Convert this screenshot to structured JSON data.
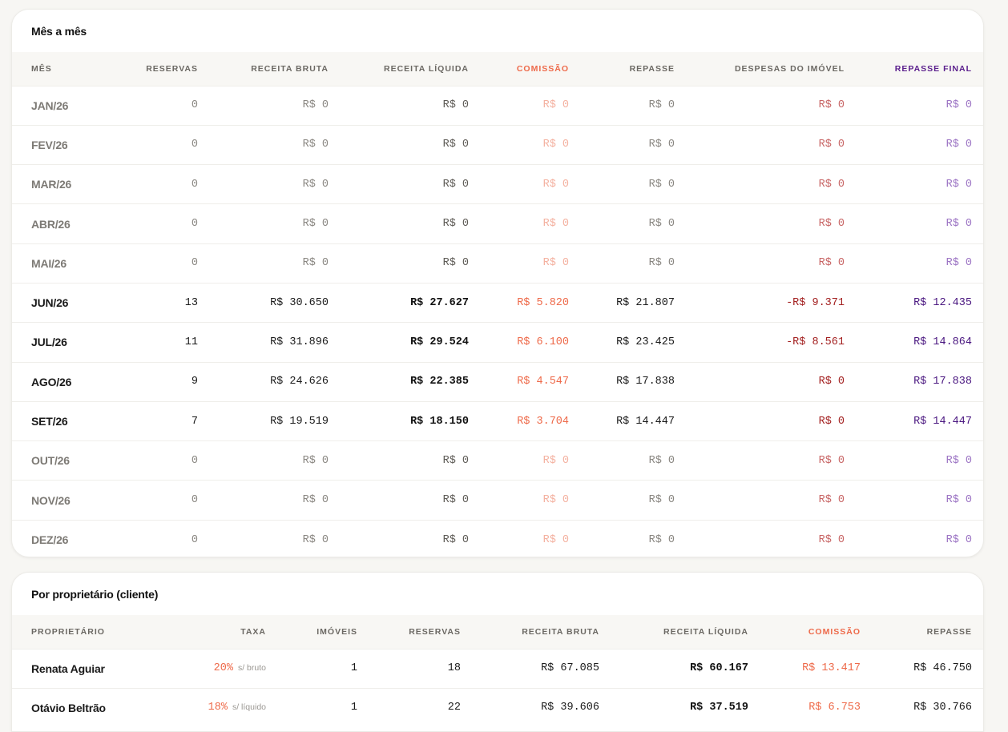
{
  "monthly": {
    "title": "Mês a mês",
    "headers": {
      "month": "MÊS",
      "bookings": "RESERVAS",
      "gross": "RECEITA BRUTA",
      "net": "RECEITA LÍQUIDA",
      "commission": "COMISSÃO",
      "payout": "REPASSE",
      "expenses": "DESPESAS DO IMÓVEL",
      "final": "REPASSE FINAL"
    },
    "rows": [
      {
        "month": "JAN/26",
        "bookings": "0",
        "gross": "R$ 0",
        "net": "R$ 0",
        "commission": "R$ 0",
        "payout": "R$ 0",
        "expenses": "R$ 0",
        "final": "R$ 0",
        "empty": true
      },
      {
        "month": "FEV/26",
        "bookings": "0",
        "gross": "R$ 0",
        "net": "R$ 0",
        "commission": "R$ 0",
        "payout": "R$ 0",
        "expenses": "R$ 0",
        "final": "R$ 0",
        "empty": true
      },
      {
        "month": "MAR/26",
        "bookings": "0",
        "gross": "R$ 0",
        "net": "R$ 0",
        "commission": "R$ 0",
        "payout": "R$ 0",
        "expenses": "R$ 0",
        "final": "R$ 0",
        "empty": true
      },
      {
        "month": "ABR/26",
        "bookings": "0",
        "gross": "R$ 0",
        "net": "R$ 0",
        "commission": "R$ 0",
        "payout": "R$ 0",
        "expenses": "R$ 0",
        "final": "R$ 0",
        "empty": true
      },
      {
        "month": "MAI/26",
        "bookings": "0",
        "gross": "R$ 0",
        "net": "R$ 0",
        "commission": "R$ 0",
        "payout": "R$ 0",
        "expenses": "R$ 0",
        "final": "R$ 0",
        "empty": true
      },
      {
        "month": "JUN/26",
        "bookings": "13",
        "gross": "R$ 30.650",
        "net": "R$ 27.627",
        "commission": "R$ 5.820",
        "payout": "R$ 21.807",
        "expenses": "-R$ 9.371",
        "final": "R$ 12.435",
        "empty": false
      },
      {
        "month": "JUL/26",
        "bookings": "11",
        "gross": "R$ 31.896",
        "net": "R$ 29.524",
        "commission": "R$ 6.100",
        "payout": "R$ 23.425",
        "expenses": "-R$ 8.561",
        "final": "R$ 14.864",
        "empty": false
      },
      {
        "month": "AGO/26",
        "bookings": "9",
        "gross": "R$ 24.626",
        "net": "R$ 22.385",
        "commission": "R$ 4.547",
        "payout": "R$ 17.838",
        "expenses": "R$ 0",
        "final": "R$ 17.838",
        "empty": false
      },
      {
        "month": "SET/26",
        "bookings": "7",
        "gross": "R$ 19.519",
        "net": "R$ 18.150",
        "commission": "R$ 3.704",
        "payout": "R$ 14.447",
        "expenses": "R$ 0",
        "final": "R$ 14.447",
        "empty": false
      },
      {
        "month": "OUT/26",
        "bookings": "0",
        "gross": "R$ 0",
        "net": "R$ 0",
        "commission": "R$ 0",
        "payout": "R$ 0",
        "expenses": "R$ 0",
        "final": "R$ 0",
        "empty": true
      },
      {
        "month": "NOV/26",
        "bookings": "0",
        "gross": "R$ 0",
        "net": "R$ 0",
        "commission": "R$ 0",
        "payout": "R$ 0",
        "expenses": "R$ 0",
        "final": "R$ 0",
        "empty": true
      },
      {
        "month": "DEZ/26",
        "bookings": "0",
        "gross": "R$ 0",
        "net": "R$ 0",
        "commission": "R$ 0",
        "payout": "R$ 0",
        "expenses": "R$ 0",
        "final": "R$ 0",
        "empty": true
      }
    ]
  },
  "owners": {
    "title": "Por proprietário (cliente)",
    "headers": {
      "owner": "PROPRIETÁRIO",
      "rate": "TAXA",
      "properties": "IMÓVEIS",
      "bookings": "RESERVAS",
      "gross": "RECEITA BRUTA",
      "net": "RECEITA LÍQUIDA",
      "commission": "COMISSÃO",
      "payout": "REPASSE"
    },
    "rows": [
      {
        "owner": "Renata Aguiar",
        "rate": "20%",
        "rate_base": "s/ bruto",
        "properties": "1",
        "bookings": "18",
        "gross": "R$ 67.085",
        "net": "R$ 60.167",
        "commission": "R$ 13.417",
        "payout": "R$ 46.750"
      },
      {
        "owner": "Otávio Beltrão",
        "rate": "18%",
        "rate_base": "s/ líquido",
        "properties": "1",
        "bookings": "22",
        "gross": "R$ 39.606",
        "net": "R$ 37.519",
        "commission": "R$ 6.753",
        "payout": "R$ 30.766"
      }
    ]
  },
  "colors": {
    "commission": "#ee6a4a",
    "expenses": "#a32020",
    "final": "#4a1780"
  }
}
